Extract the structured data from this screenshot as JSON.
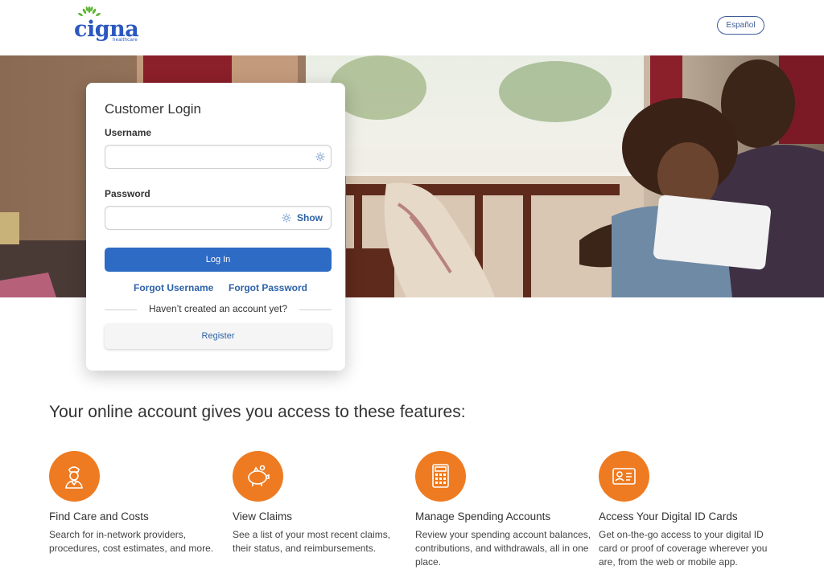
{
  "header": {
    "logo_text": "cigna",
    "logo_subtext": "healthcare",
    "language_button": "Español"
  },
  "login": {
    "title": "Customer Login",
    "username_label": "Username",
    "username_value": "",
    "password_label": "Password",
    "password_value": "",
    "show_label": "Show",
    "login_button": "Log In",
    "forgot_username": "Forgot Username",
    "forgot_password": "Forgot Password",
    "no_account_text": "Haven’t created an account yet?",
    "register_button": "Register"
  },
  "features": {
    "heading": "Your online account gives you access to these features:",
    "items": [
      {
        "icon": "doctor-icon",
        "title": "Find Care and Costs",
        "description": "Search for in-network providers, procedures, cost estimates, and more."
      },
      {
        "icon": "piggy-bank-icon",
        "title": "View Claims",
        "description": "See a list of your most recent claims, their status, and reimbursements."
      },
      {
        "icon": "calculator-icon",
        "title": "Manage Spending Accounts",
        "description": "Review your spending account balances, contributions, and withdrawals, all in one place."
      },
      {
        "icon": "id-card-icon",
        "title": "Access Your Digital ID Cards",
        "description": "Get on-the-go access to your digital ID card or proof of coverage wherever you are, from the web or mobile app."
      }
    ]
  },
  "colors": {
    "brand_blue": "#2b57c0",
    "login_button": "#2d6bc4",
    "link_blue": "#2d62a8",
    "feature_orange": "#ee7b22"
  }
}
